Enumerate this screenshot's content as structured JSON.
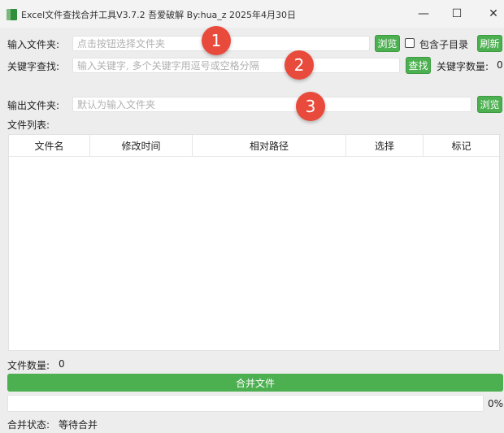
{
  "window": {
    "title": "Excel文件查找合并工具V3.7.2 吾爱破解 By:hua_z 2025年4月30日",
    "minimize_glyph": "—",
    "maximize_glyph": "☐",
    "close_glyph": "✕"
  },
  "input_folder": {
    "label": "输入文件夹:",
    "placeholder": "点击按钮选择文件夹",
    "value": "",
    "browse_label": "浏览",
    "include_subdirs_label": "包含子目录",
    "include_subdirs_checked": false,
    "refresh_label": "刷新"
  },
  "keyword": {
    "label": "关键字查找:",
    "placeholder": "输入关键字, 多个关键字用逗号或空格分隔",
    "value": "",
    "search_label": "查找",
    "count_label": "关键字数量:",
    "count": "0"
  },
  "output_folder": {
    "label": "输出文件夹:",
    "placeholder": "默认为输入文件夹",
    "value": "",
    "browse_label": "浏览"
  },
  "file_list": {
    "label": "文件列表:",
    "columns": [
      "文件名",
      "修改时间",
      "相对路径",
      "选择",
      "标记"
    ],
    "rows": []
  },
  "file_count": {
    "label": "文件数量:",
    "value": "0"
  },
  "merge_button_label": "合并文件",
  "progress": {
    "value": 0,
    "text": "0%"
  },
  "merge_status": {
    "label": "合并状态:",
    "value": "等待合并"
  },
  "annotations": [
    "1",
    "2",
    "3"
  ],
  "colors": {
    "accent_green": "#4caf50",
    "badge_red": "#e84a3c"
  }
}
